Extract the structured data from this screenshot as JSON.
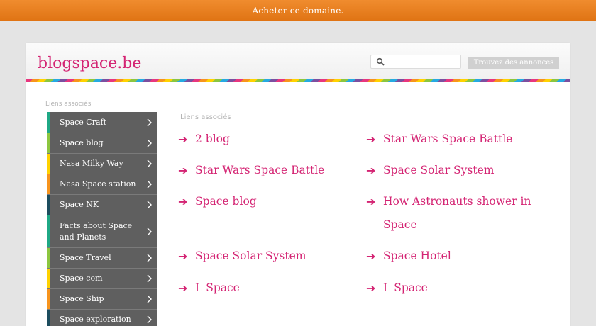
{
  "topbar": {
    "label": "Acheter ce domaine."
  },
  "header": {
    "logo": "blogspace.be",
    "search_placeholder": "",
    "search_button": "Trouvez des annonces"
  },
  "sidebar": {
    "label": "Liens associés",
    "items": [
      {
        "label": "Space Craft",
        "accent": "#1fa885"
      },
      {
        "label": "Space blog",
        "accent": "#8cc63f"
      },
      {
        "label": "Nasa Milky Way",
        "accent": "#ffd200"
      },
      {
        "label": "Nasa Space station",
        "accent": "#f7941d"
      },
      {
        "label": "Space NK",
        "accent": "#1d4d5e"
      },
      {
        "label": "Facts about Space and Planets",
        "accent": "#1fa885"
      },
      {
        "label": "Space Travel",
        "accent": "#8cc63f"
      },
      {
        "label": "Space com",
        "accent": "#ffd200"
      },
      {
        "label": "Space Ship",
        "accent": "#f7941d"
      },
      {
        "label": "Space exploration",
        "accent": "#1d4d5e"
      }
    ]
  },
  "main": {
    "label": "Liens associés",
    "arrow": "➔",
    "links": [
      {
        "label": "2 blog"
      },
      {
        "label": "Star Wars Space Battle"
      },
      {
        "label": "Star Wars Space Battle"
      },
      {
        "label": "Space Solar System"
      },
      {
        "label": "Space blog"
      },
      {
        "label": "How Astronauts shower in Space"
      },
      {
        "label": "Space Solar System"
      },
      {
        "label": "Space Hotel"
      },
      {
        "label": "L Space"
      },
      {
        "label": "L Space"
      }
    ]
  },
  "colors": {
    "accent": "#d42473",
    "topbar": "#e07414"
  }
}
